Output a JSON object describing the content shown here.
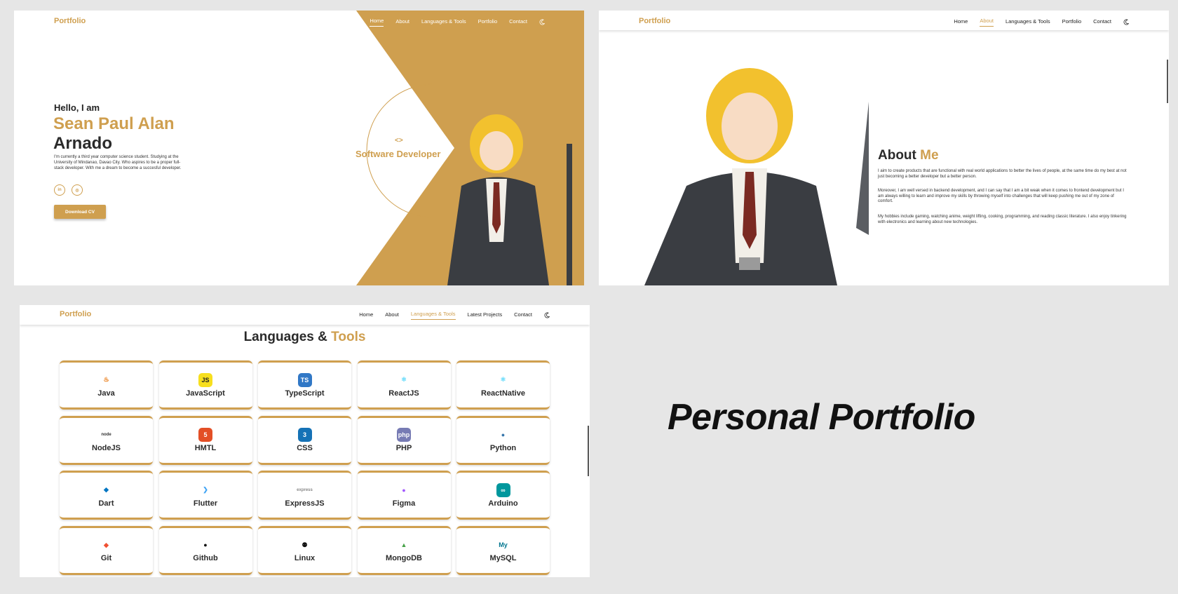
{
  "hero_panel": {
    "logo": "Portfolio",
    "nav": [
      "Home",
      "About",
      "Languages & Tools",
      "Portfolio",
      "Contact"
    ],
    "active_nav": "Home",
    "greeting": "Hello, I am",
    "name_first": "Sean Paul Alan",
    "name_last": "Arnado",
    "bio": "I'm currently a third year computer science student. Studying at the University of Mindanao, Davao City. Who aspires to be a proper full-stack developer. With me a dream to become a succesful developer.",
    "social": [
      {
        "icon": "linkedin-icon",
        "text": "in"
      },
      {
        "icon": "github-icon",
        "text": "◎"
      }
    ],
    "cv_button": "Download CV",
    "code_icon": "<>",
    "role": "Software Developer",
    "accent": "#cf9f4f"
  },
  "about_panel": {
    "logo": "Portfolio",
    "nav": [
      "Home",
      "About",
      "Languages & Tools",
      "Portfolio",
      "Contact"
    ],
    "active_nav": "About",
    "title_a": "About ",
    "title_b": "Me",
    "paragraphs": [
      "I aim to create products that are functional with real world applications to better the lives of people, at the same time do my best at not just becoming a better developer but a better person.",
      "Moreover, I am well versed in backend development, and I can say that I am a bit weak when it comes to frontend development but I am always willing to learn and improve my skills by throwing myself into challenges that will keep pushing me out of my zone of comfort.",
      "My hobbies include gaming, watching anime, weight lifting, cooking, programming, and reading classic literature. I also enjoy tinkering with electronics and learning about new technologies."
    ]
  },
  "tools_panel": {
    "logo": "Portfolio",
    "nav": [
      "Home",
      "About",
      "Languages & Tools",
      "Latest Projects",
      "Contact"
    ],
    "active_nav": "Languages & Tools",
    "title_a": "Languages & ",
    "title_b": "Tools",
    "tools": [
      {
        "name": "Java",
        "icon": "java-icon",
        "glyph": "♨",
        "color": "#e76f00",
        "bg": "transparent"
      },
      {
        "name": "JavaScript",
        "icon": "javascript-icon",
        "glyph": "JS",
        "color": "#222",
        "bg": "#f7df1e"
      },
      {
        "name": "TypeScript",
        "icon": "typescript-icon",
        "glyph": "TS",
        "color": "#fff",
        "bg": "#3178c6"
      },
      {
        "name": "ReactJS",
        "icon": "react-icon",
        "glyph": "⚛",
        "color": "#61dafb",
        "bg": "transparent"
      },
      {
        "name": "ReactNative",
        "icon": "react-native-icon",
        "glyph": "⚛",
        "color": "#61dafb",
        "bg": "transparent"
      },
      {
        "name": "NodeJS",
        "icon": "nodejs-icon",
        "glyph": "node",
        "color": "#333",
        "bg": "transparent"
      },
      {
        "name": "HMTL",
        "icon": "html5-icon",
        "glyph": "5",
        "color": "#fff",
        "bg": "#e34f26"
      },
      {
        "name": "CSS",
        "icon": "css3-icon",
        "glyph": "3",
        "color": "#fff",
        "bg": "#1572b6"
      },
      {
        "name": "PHP",
        "icon": "php-icon",
        "glyph": "php",
        "color": "#fff",
        "bg": "#777bb4"
      },
      {
        "name": "Python",
        "icon": "python-icon",
        "glyph": "●",
        "color": "#3776ab",
        "bg": "transparent"
      },
      {
        "name": "Dart",
        "icon": "dart-icon",
        "glyph": "◆",
        "color": "#0175c2",
        "bg": "transparent"
      },
      {
        "name": "Flutter",
        "icon": "flutter-icon",
        "glyph": "❯",
        "color": "#42a5f5",
        "bg": "transparent"
      },
      {
        "name": "ExpressJS",
        "icon": "express-icon",
        "glyph": "express",
        "color": "#888",
        "bg": "transparent"
      },
      {
        "name": "Figma",
        "icon": "figma-icon",
        "glyph": "●",
        "color": "#a259ff",
        "bg": "transparent"
      },
      {
        "name": "Arduino",
        "icon": "arduino-icon",
        "glyph": "∞",
        "color": "#fff",
        "bg": "#00979d"
      },
      {
        "name": "Git",
        "icon": "git-icon",
        "glyph": "◆",
        "color": "#f05032",
        "bg": "transparent"
      },
      {
        "name": "Github",
        "icon": "github-icon",
        "glyph": "●",
        "color": "#111",
        "bg": "transparent"
      },
      {
        "name": "Linux",
        "icon": "linux-icon",
        "glyph": "⚉",
        "color": "#111",
        "bg": "transparent"
      },
      {
        "name": "MongoDB",
        "icon": "mongodb-icon",
        "glyph": "▲",
        "color": "#47a248",
        "bg": "transparent"
      },
      {
        "name": "MySQL",
        "icon": "mysql-icon",
        "glyph": "My",
        "color": "#00758f",
        "bg": "transparent"
      }
    ]
  },
  "caption": "Personal Portfolio"
}
